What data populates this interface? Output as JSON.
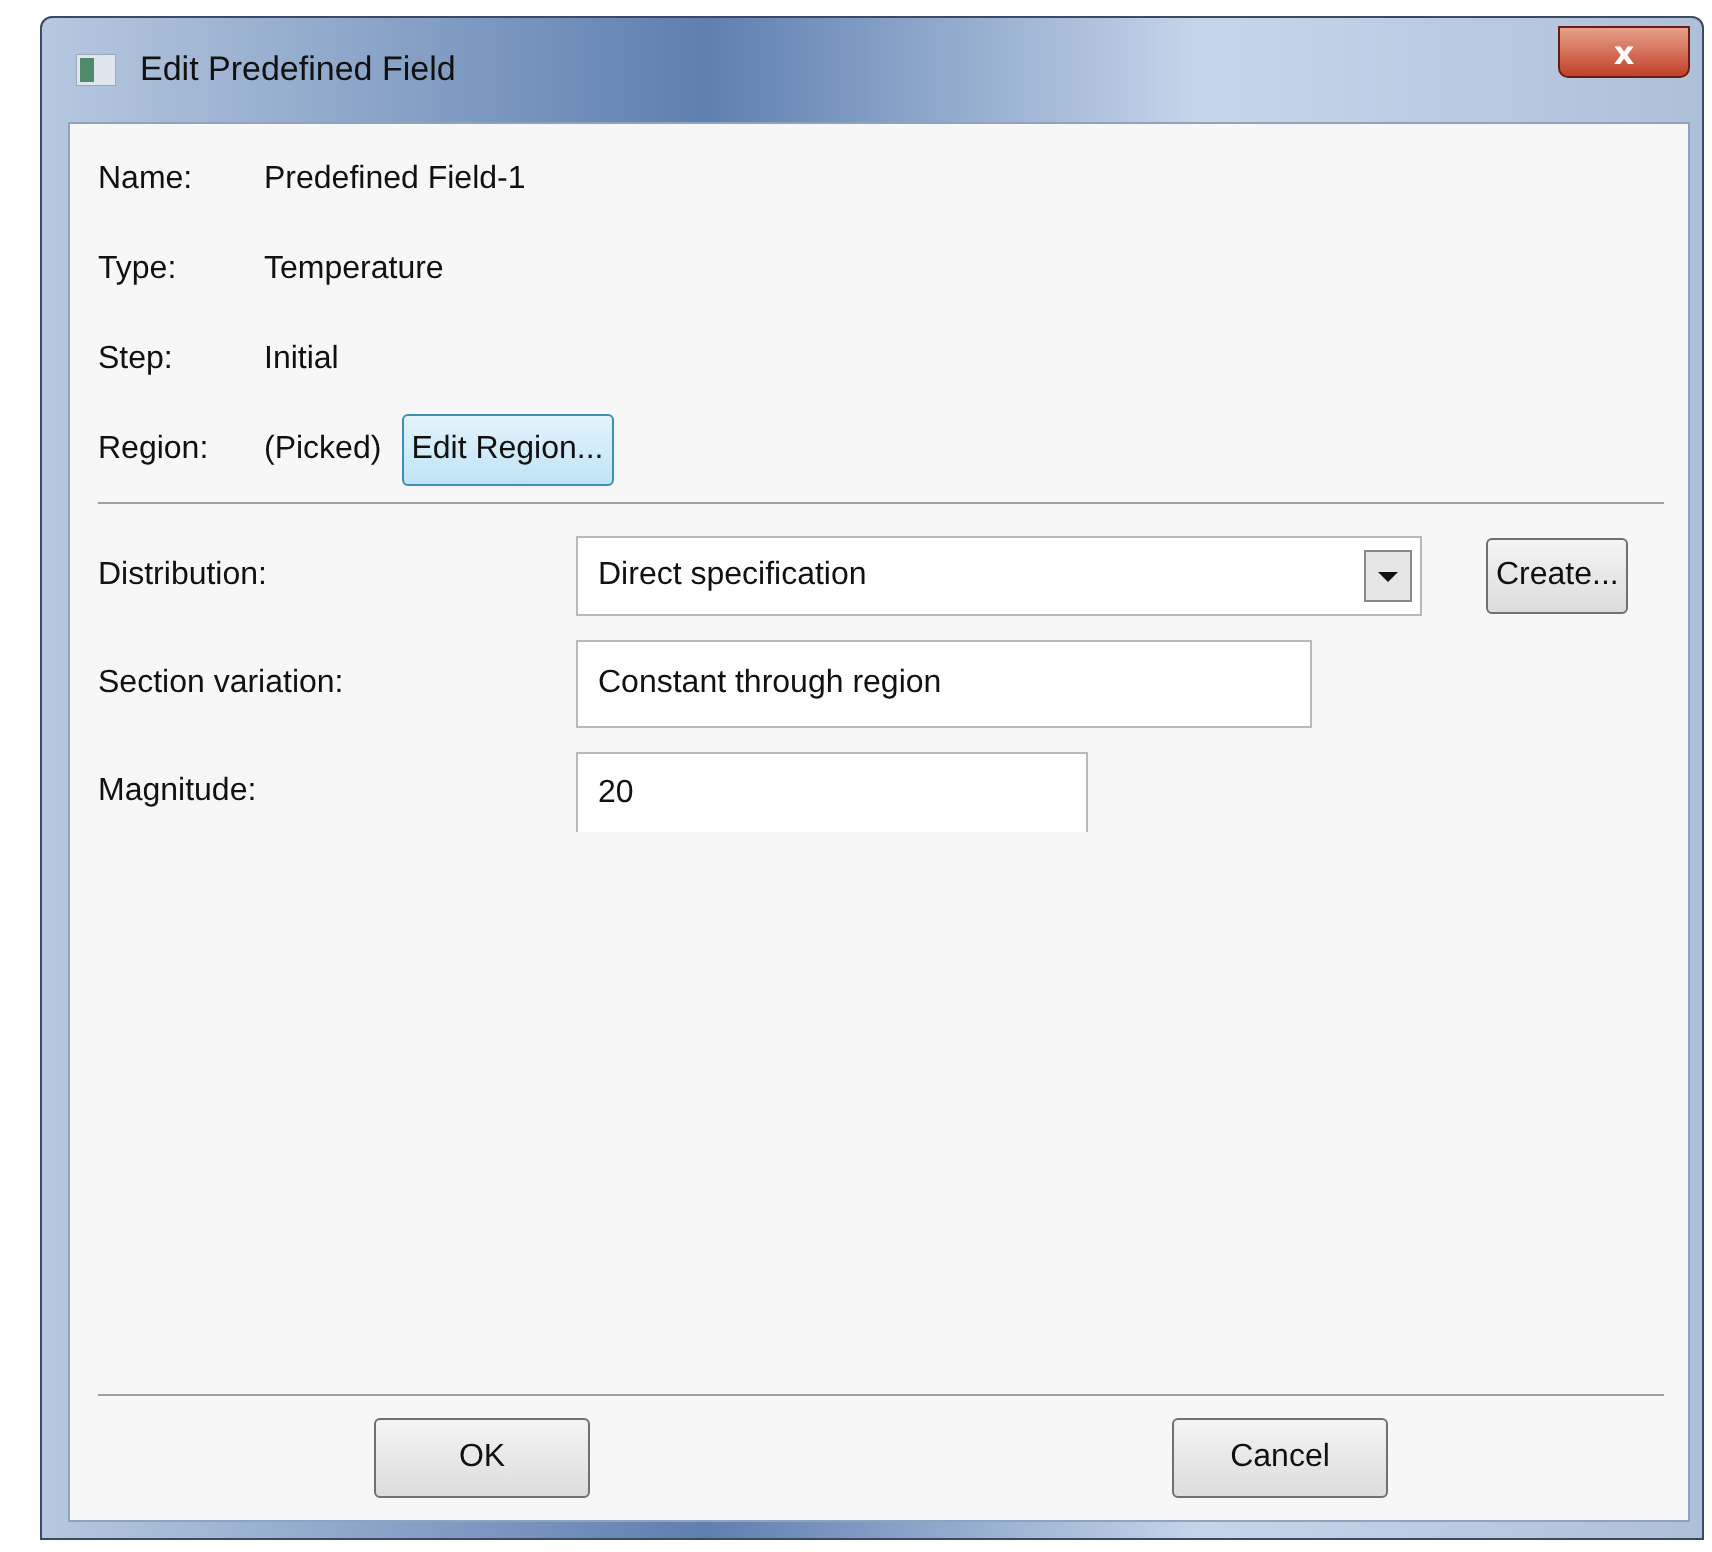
{
  "window": {
    "title": "Edit Predefined Field",
    "close": "x"
  },
  "info": [
    {
      "label": "Name:",
      "value": "Predefined Field-1"
    },
    {
      "label": "Type:",
      "value": "Temperature"
    },
    {
      "label": "Step:",
      "value": "Initial"
    },
    {
      "label": "Region:",
      "value": "(Picked)"
    }
  ],
  "edit_region_button": {
    "label": "Edit Region...",
    "focused": true
  },
  "fields": [
    {
      "kind": "dropdown",
      "label": "Distribution:",
      "value": "Direct specification",
      "button": "Create..."
    },
    {
      "kind": "text",
      "label": "Section variation:",
      "value": "Constant through region"
    },
    {
      "kind": "text",
      "label": "Magnitude:",
      "value": "20"
    }
  ],
  "buttons": [
    "OK",
    "Cancel"
  ]
}
